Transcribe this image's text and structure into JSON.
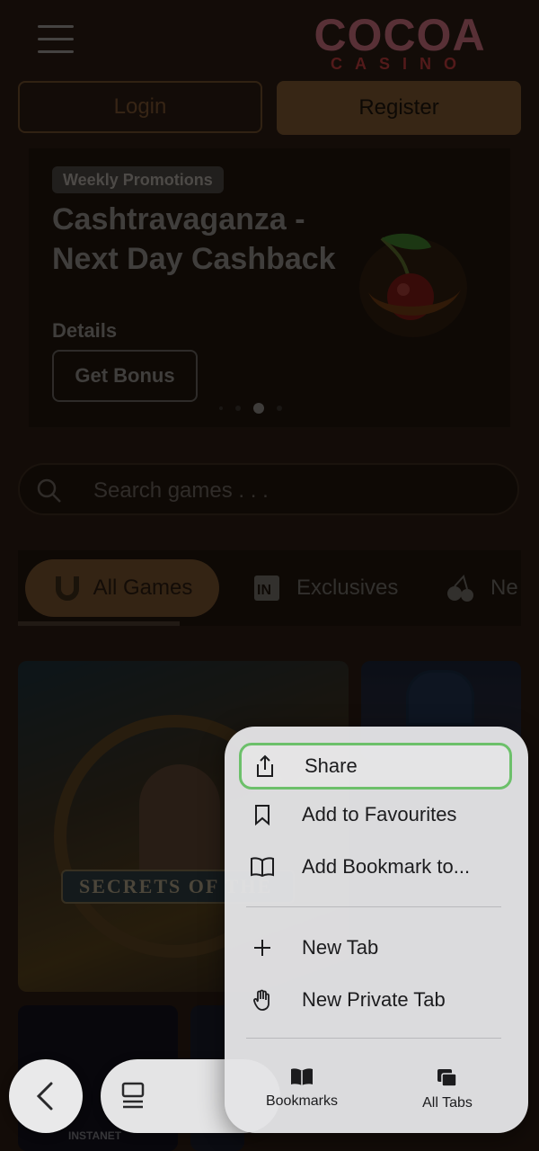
{
  "brand": {
    "logo_top": "COCOA",
    "logo_bottom": "CASINO"
  },
  "header": {
    "login_label": "Login",
    "register_label": "Register"
  },
  "promo": {
    "badge": "Weekly Promotions",
    "title": "Cashtravaganza - Next Day Cashback",
    "details_label": "Details",
    "cta_label": "Get Bonus",
    "carousel_active_index": 2,
    "carousel_count": 4
  },
  "search": {
    "placeholder": "Search games . . ."
  },
  "categories": [
    {
      "label": "All Games",
      "icon": "horseshoe-icon",
      "active": true
    },
    {
      "label": "Exclusives",
      "icon": "in-badge-icon",
      "active": false
    },
    {
      "label": "Ne",
      "icon": "cherries-icon",
      "active": false
    }
  ],
  "games": [
    {
      "title": "SECRETS OF THE",
      "tile": "large"
    },
    {
      "title": "",
      "tile": "small"
    },
    {
      "title": "INSTANET",
      "tile": "small"
    }
  ],
  "context_menu": {
    "items": [
      {
        "label": "Share",
        "icon": "share-icon",
        "focused": true
      },
      {
        "label": "Add to Favourites",
        "icon": "bookmark-icon"
      },
      {
        "label": "Add Bookmark to...",
        "icon": "book-open-icon"
      },
      {
        "label": "New Tab",
        "icon": "plus-icon"
      },
      {
        "label": "New Private Tab",
        "icon": "hand-icon"
      }
    ],
    "bottom": {
      "bookmarks_label": "Bookmarks",
      "all_tabs_label": "All Tabs"
    }
  },
  "colors": {
    "accent": "#7a5530",
    "focus_ring": "#6cc06a",
    "menu_bg": "#e4e4e6"
  }
}
